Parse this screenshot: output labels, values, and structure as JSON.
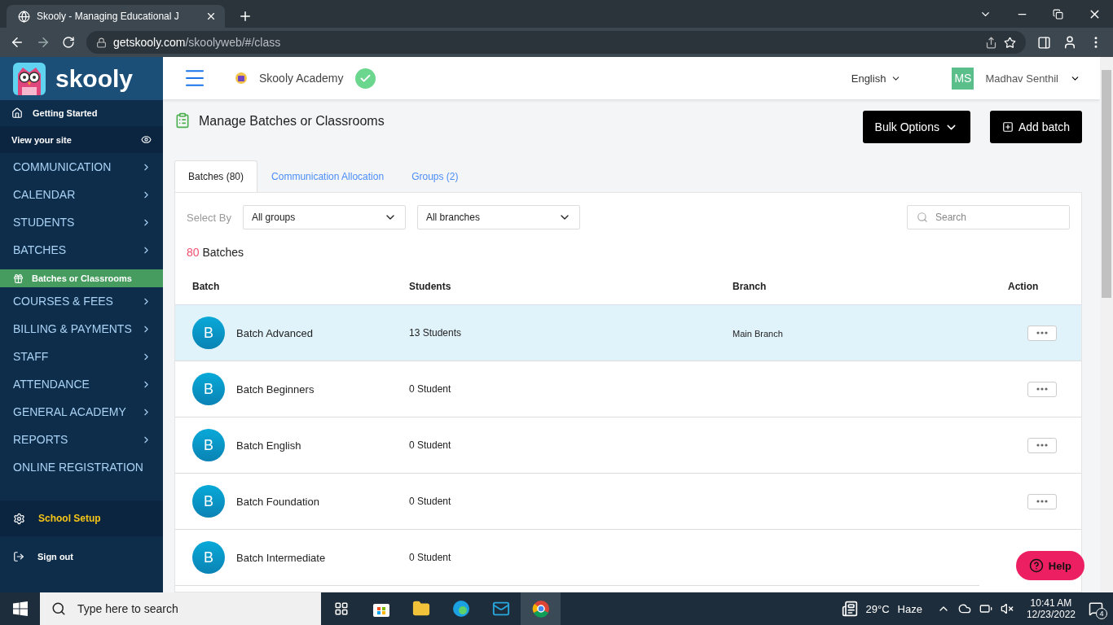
{
  "browser": {
    "tab_title": "Skooly - Managing Educational J",
    "url_host": "getskooly.com",
    "url_path": "/skoolyweb/#/class"
  },
  "sidebar": {
    "logo_text": "skooly",
    "top": [
      {
        "kind": "start",
        "label": "Getting Started"
      },
      {
        "kind": "site",
        "label": "View your site"
      }
    ],
    "menu": [
      {
        "kind": "menu",
        "label": "COMMUNICATION",
        "selected": false
      },
      {
        "kind": "menu",
        "label": "CALENDAR",
        "selected": false
      },
      {
        "kind": "menu",
        "label": "STUDENTS",
        "selected": false
      },
      {
        "kind": "menu",
        "label": "BATCHES",
        "selected": false
      },
      {
        "kind": "subitem",
        "label": "Batches or Classrooms",
        "selected": true
      },
      {
        "kind": "menu",
        "label": "COURSES & FEES",
        "selected": false
      },
      {
        "kind": "menu",
        "label": "BILLING & PAYMENTS",
        "selected": false
      },
      {
        "kind": "menu",
        "label": "STAFF",
        "selected": false
      },
      {
        "kind": "menu",
        "label": "ATTENDANCE",
        "selected": false
      },
      {
        "kind": "menu",
        "label": "GENERAL ACADEMY",
        "selected": false
      },
      {
        "kind": "menu",
        "label": "REPORTS",
        "selected": false
      },
      {
        "kind": "menu",
        "label": "ONLINE REGISTRATION",
        "selected": false
      }
    ],
    "setup": "School Setup",
    "signout": "Sign out"
  },
  "header": {
    "academy": "Skooly Academy",
    "language": "English",
    "user_initials": "MS",
    "user_name": "Madhav Senthil"
  },
  "page": {
    "title": "Manage Batches or Classrooms",
    "buttons": [
      {
        "kind": "dropdown",
        "label": "Bulk Options"
      },
      {
        "kind": "add",
        "label": "Add batch"
      }
    ]
  },
  "tabs": [
    {
      "label": "Batches (80)",
      "selected": true
    },
    {
      "label": "Communication Allocation",
      "selected": false
    },
    {
      "label": "Groups (2)",
      "selected": false
    }
  ],
  "filters": {
    "label": "Select By",
    "dropdowns": [
      "All groups",
      "All branches"
    ],
    "search_placeholder": "Search"
  },
  "count": {
    "number": "80",
    "label": "Batches"
  },
  "table": {
    "columns": [
      "Batch",
      "Students",
      "Branch",
      "Action"
    ],
    "rows": [
      {
        "initial": "B",
        "name": "Batch Advanced",
        "students": "13 Students",
        "branch": "Main Branch",
        "selected": true
      },
      {
        "initial": "B",
        "name": "Batch Beginners",
        "students": "0 Student",
        "selected": false
      },
      {
        "initial": "B",
        "name": "Batch English",
        "students": "0 Student",
        "selected": false
      },
      {
        "initial": "B",
        "name": "Batch Foundation",
        "students": "0 Student",
        "selected": false
      },
      {
        "initial": "B",
        "name": "Batch Intermediate",
        "students": "0 Student",
        "selected": false,
        "menu_hidden": true
      }
    ]
  },
  "help": "Help",
  "taskbar": {
    "search_placeholder": "Type here to search",
    "temperature": "29°C",
    "weather": "Haze",
    "time": "10:41 AM",
    "date": "12/23/2022",
    "notifications": "4"
  }
}
